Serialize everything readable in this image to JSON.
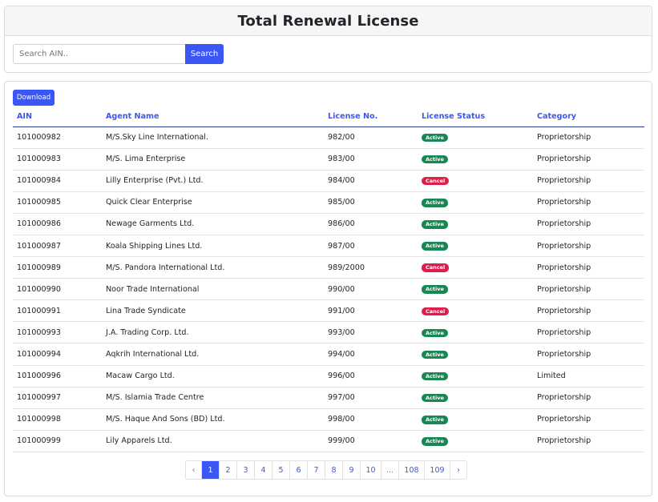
{
  "header": {
    "title": "Total Renewal License"
  },
  "search": {
    "placeholder": "Search AIN..",
    "value": "",
    "button_label": "Search"
  },
  "toolbar": {
    "download_label": "Download"
  },
  "table": {
    "columns": [
      "AIN",
      "Agent Name",
      "License No.",
      "License Status",
      "Category"
    ],
    "rows": [
      {
        "ain": "101000982",
        "agent": "M/S.Sky Line International.",
        "license": "982/00",
        "status": "Active",
        "category": "Proprietorship"
      },
      {
        "ain": "101000983",
        "agent": "M/S. Lima Enterprise",
        "license": "983/00",
        "status": "Active",
        "category": "Proprietorship"
      },
      {
        "ain": "101000984",
        "agent": "Lilly Enterprise (Pvt.) Ltd.",
        "license": "984/00",
        "status": "Cancel",
        "category": "Proprietorship"
      },
      {
        "ain": "101000985",
        "agent": "Quick Clear Enterprise",
        "license": "985/00",
        "status": "Active",
        "category": "Proprietorship"
      },
      {
        "ain": "101000986",
        "agent": "Newage Garments Ltd.",
        "license": "986/00",
        "status": "Active",
        "category": "Proprietorship"
      },
      {
        "ain": "101000987",
        "agent": "Koala Shipping Lines Ltd.",
        "license": "987/00",
        "status": "Active",
        "category": "Proprietorship"
      },
      {
        "ain": "101000989",
        "agent": "M/S. Pandora International Ltd.",
        "license": "989/2000",
        "status": "Cancel",
        "category": "Proprietorship"
      },
      {
        "ain": "101000990",
        "agent": "Noor Trade International",
        "license": "990/00",
        "status": "Active",
        "category": "Proprietorship"
      },
      {
        "ain": "101000991",
        "agent": "Lina Trade Syndicate",
        "license": "991/00",
        "status": "Cancel",
        "category": "Proprietorship"
      },
      {
        "ain": "101000993",
        "agent": "J.A. Trading Corp. Ltd.",
        "license": "993/00",
        "status": "Active",
        "category": "Proprietorship"
      },
      {
        "ain": "101000994",
        "agent": "Aqkrih International Ltd.",
        "license": "994/00",
        "status": "Active",
        "category": "Proprietorship"
      },
      {
        "ain": "101000996",
        "agent": "Macaw Cargo Ltd.",
        "license": "996/00",
        "status": "Active",
        "category": "Limited"
      },
      {
        "ain": "101000997",
        "agent": "M/S. Islamia Trade Centre",
        "license": "997/00",
        "status": "Active",
        "category": "Proprietorship"
      },
      {
        "ain": "101000998",
        "agent": "M/S. Haque And Sons (BD) Ltd.",
        "license": "998/00",
        "status": "Active",
        "category": "Proprietorship"
      },
      {
        "ain": "101000999",
        "agent": "Lily Apparels Ltd.",
        "license": "999/00",
        "status": "Active",
        "category": "Proprietorship"
      }
    ]
  },
  "status_colors": {
    "Active": "#198754",
    "Cancel": "#dc1f4a"
  },
  "pagination": {
    "prev_label": "‹",
    "next_label": "›",
    "pages": [
      "1",
      "2",
      "3",
      "4",
      "5",
      "6",
      "7",
      "8",
      "9",
      "10",
      "...",
      "108",
      "109"
    ],
    "current": "1"
  }
}
